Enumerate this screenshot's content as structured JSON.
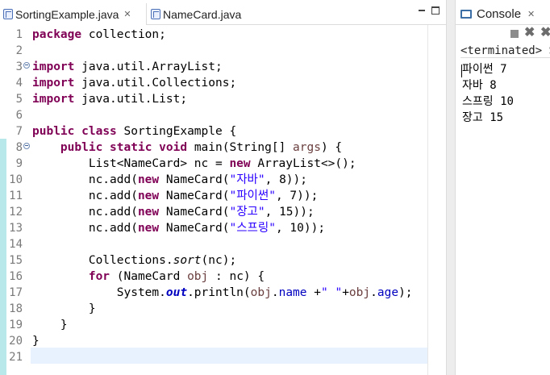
{
  "editor": {
    "tabs": [
      {
        "label": "SortingExample.java",
        "close": "✕",
        "icon": "java-file-icon"
      },
      {
        "label": "NameCard.java",
        "icon": "java-file-icon"
      }
    ],
    "line_numbers": [
      "1",
      "2",
      "3",
      "4",
      "5",
      "6",
      "7",
      "8",
      "9",
      "10",
      "11",
      "12",
      "13",
      "14",
      "15",
      "16",
      "17",
      "18",
      "19",
      "20",
      "21"
    ],
    "code": {
      "l1_kw": "package",
      "l1_rest": " collection;",
      "l3_kw": "import",
      "l3_rest": " java.util.ArrayList;",
      "l4_kw": "import",
      "l4_rest": " java.util.Collections;",
      "l5_kw": "import",
      "l5_rest": " java.util.List;",
      "l7_kw1": "public",
      "l7_sp": " ",
      "l7_kw2": "class",
      "l7_rest": " SortingExample {",
      "l8_indent": "    ",
      "l8_kw1": "public",
      "l8_sp1": " ",
      "l8_kw2": "static",
      "l8_sp2": " ",
      "l8_kw3": "void",
      "l8_rest": " main(String[] ",
      "l8_param": "args",
      "l8_end": ") {",
      "l9_a": "        List<NameCard> nc = ",
      "l9_kw": "new",
      "l9_b": " ArrayList<>();",
      "l10_a": "        nc.add(",
      "l10_kw": "new",
      "l10_b": " NameCard(",
      "l10_str": "\"자바\"",
      "l10_c": ", 8));",
      "l11_a": "        nc.add(",
      "l11_kw": "new",
      "l11_b": " NameCard(",
      "l11_str": "\"파이썬\"",
      "l11_c": ", 7));",
      "l12_a": "        nc.add(",
      "l12_kw": "new",
      "l12_b": " NameCard(",
      "l12_str": "\"장고\"",
      "l12_c": ", 15));",
      "l13_a": "        nc.add(",
      "l13_kw": "new",
      "l13_b": " NameCard(",
      "l13_str": "\"스프링\"",
      "l13_c": ", 10));",
      "l15_a": "        Collections.",
      "l15_ital": "sort",
      "l15_b": "(nc);",
      "l16_a": "        ",
      "l16_kw": "for",
      "l16_b": " (NameCard ",
      "l16_param": "obj",
      "l16_c": " : nc) {",
      "l17_a": "            System.",
      "l17_stat": "out",
      "l17_b": ".println(",
      "l17_p1": "obj",
      "l17_c": ".",
      "l17_f1": "name",
      "l17_d": " +",
      "l17_str": "\" \"",
      "l17_e": "+",
      "l17_p2": "obj",
      "l17_g": ".",
      "l17_f2": "age",
      "l17_h": ");",
      "l18": "        }",
      "l19": "    }",
      "l20": "}"
    }
  },
  "console": {
    "tab_label": "Console",
    "tab_close": "✕",
    "status": "<terminated> SortingExample [Java Application]",
    "output": [
      "파이썬 7",
      "자바 8",
      "스프링 10",
      "장고 15"
    ]
  }
}
